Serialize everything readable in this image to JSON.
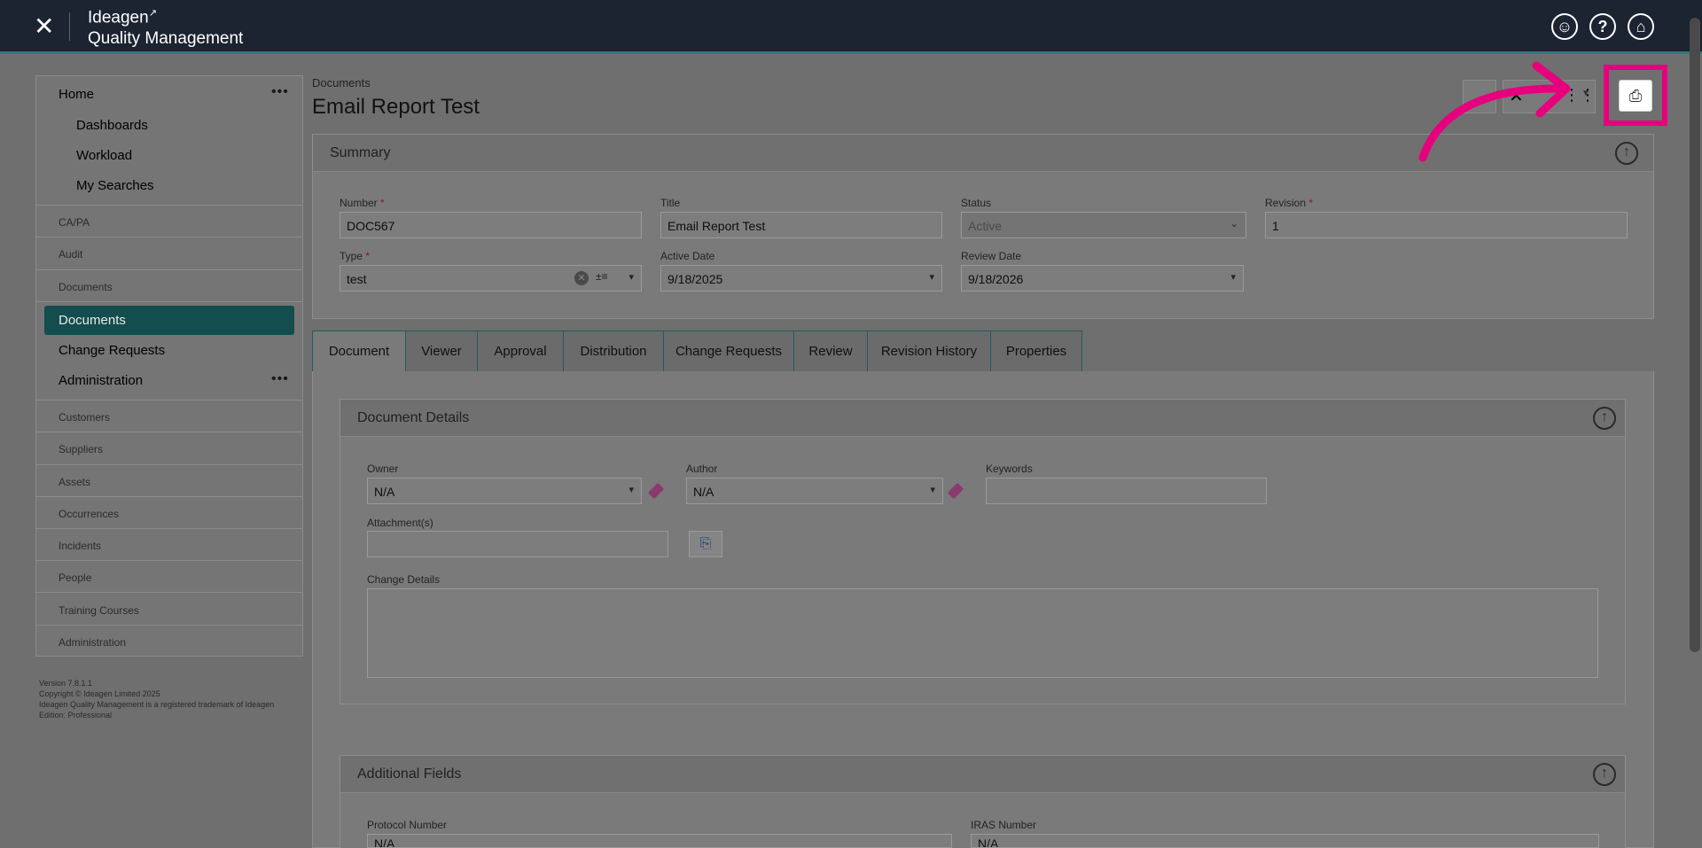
{
  "app": {
    "close_icon": "close-icon",
    "brand_line1": "Ideagen",
    "brand_line2": "Quality Management"
  },
  "header_icons": [
    "user-circle-icon",
    "help-icon",
    "home-icon"
  ],
  "sidebar": {
    "home": "Home",
    "home_children": [
      "Dashboards",
      "Workload",
      "My Searches"
    ],
    "sections": [
      "CA/PA",
      "Audit",
      "Documents"
    ],
    "active_item": "Documents",
    "change_requests": "Change Requests",
    "administration": "Administration",
    "admin_sections": [
      "Customers",
      "Suppliers",
      "Assets",
      "Occurrences",
      "Incidents",
      "People",
      "Training Courses",
      "Administration"
    ],
    "version_lines": [
      "Version 7.8.1.1",
      "Copyright © Ideagen Limited 2025",
      "Ideagen Quality Management is a registered trademark of Ideagen",
      "Edition: Professional"
    ]
  },
  "breadcrumb": "Documents",
  "title": "Email Report Test",
  "summary": {
    "heading": "Summary",
    "number_label": "Number",
    "number_value": "DOC567",
    "title_label": "Title",
    "title_value": "Email Report Test",
    "status_label": "Status",
    "status_value": "Active",
    "revision_label": "Revision",
    "revision_value": "1",
    "type_label": "Type",
    "type_value": "test",
    "active_date_label": "Active Date",
    "active_date_value": "9/18/2025",
    "review_date_label": "Review Date",
    "review_date_value": "9/18/2026"
  },
  "tabs": [
    "Document",
    "Viewer",
    "Approval",
    "Distribution",
    "Change Requests",
    "Review",
    "Revision History",
    "Properties"
  ],
  "document_details": {
    "heading": "Document Details",
    "owner_label": "Owner",
    "owner_value": "N/A",
    "author_label": "Author",
    "author_value": "N/A",
    "keywords_label": "Keywords",
    "keywords_value": "",
    "attachments_label": "Attachment(s)",
    "change_details_label": "Change Details"
  },
  "additional_fields": {
    "heading": "Additional Fields",
    "protocol_label": "Protocol Number",
    "protocol_value": "N/A",
    "iras_label": "IRAS Number",
    "iras_value": "N/A"
  },
  "colors": {
    "topbar": "#1c2431",
    "active_nav": "#134d4d",
    "highlight": "#e6007e"
  }
}
